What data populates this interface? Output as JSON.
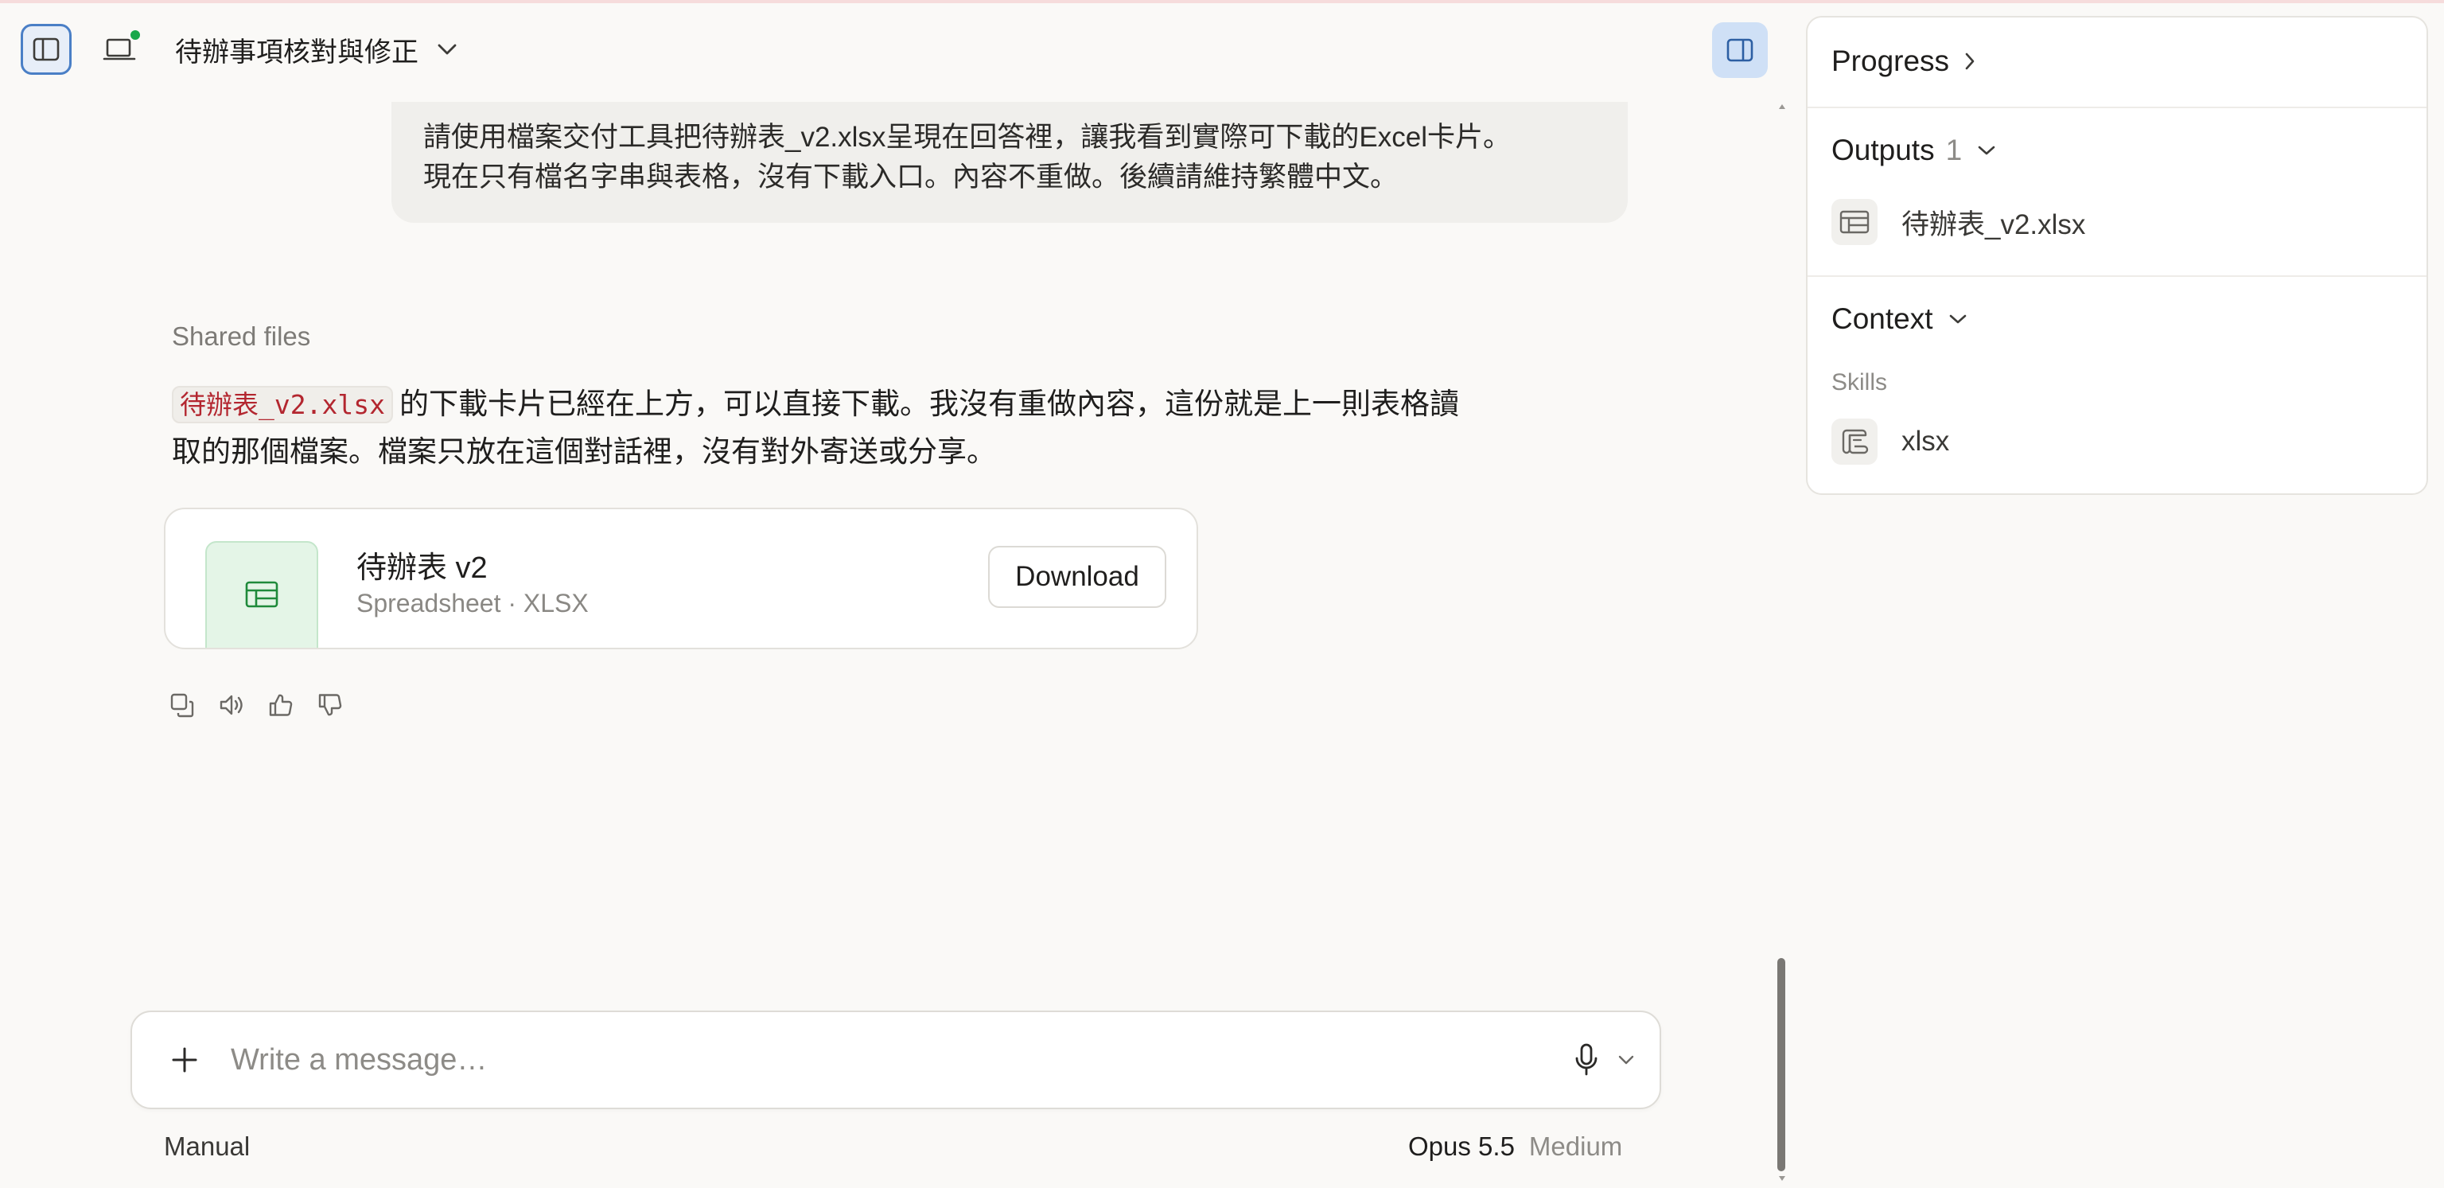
{
  "header": {
    "conversation_title": "待辦事項核對與修正"
  },
  "conversation": {
    "user_message": {
      "lines": [
        "請使用檔案交付工具把待辦表_v2.xlsx呈現在回答裡，讓我看到實際可下載的Excel卡片。",
        "現在只有檔名字串與表格，沒有下載入口。內容不重做。後續請維持繁體中文。"
      ]
    },
    "assistant_message": {
      "section_label": "Shared files",
      "code_filename": "待辦表_v2.xlsx",
      "text_line1": "的下載卡片已經在上方，可以直接下載。我沒有重做內容，這份就是上一則表格讀",
      "text_line2": "取的那個檔案。檔案只放在這個對話裡，沒有對外寄送或分享。",
      "file_card": {
        "name": "待辦表 v2",
        "meta": "Spreadsheet · XLSX",
        "download_label": "Download",
        "icon": "spreadsheet-icon"
      },
      "actions": [
        "copy-icon",
        "speaker-icon",
        "thumbs-up-icon",
        "thumbs-down-icon"
      ]
    }
  },
  "composer": {
    "placeholder": "Write a message…",
    "mode": "Manual",
    "model": "Opus 5.5",
    "effort": "Medium"
  },
  "right_panel": {
    "progress": {
      "label": "Progress"
    },
    "outputs": {
      "label": "Outputs",
      "count": "1",
      "items": [
        {
          "name": "待辦表_v2.xlsx",
          "icon": "spreadsheet-icon"
        }
      ]
    },
    "context": {
      "label": "Context",
      "skills_label": "Skills",
      "skills": [
        {
          "name": "xlsx",
          "icon": "scroll-icon"
        }
      ]
    }
  },
  "colors": {
    "accent_blue": "#4a7fc6",
    "panel_toggle_bg": "#cfe0f6",
    "status_dot": "#1aa84b",
    "code_text": "#b3262f",
    "file_thumb_bg": "#e4f5e7",
    "file_thumb_icon": "#1f8a3b"
  }
}
